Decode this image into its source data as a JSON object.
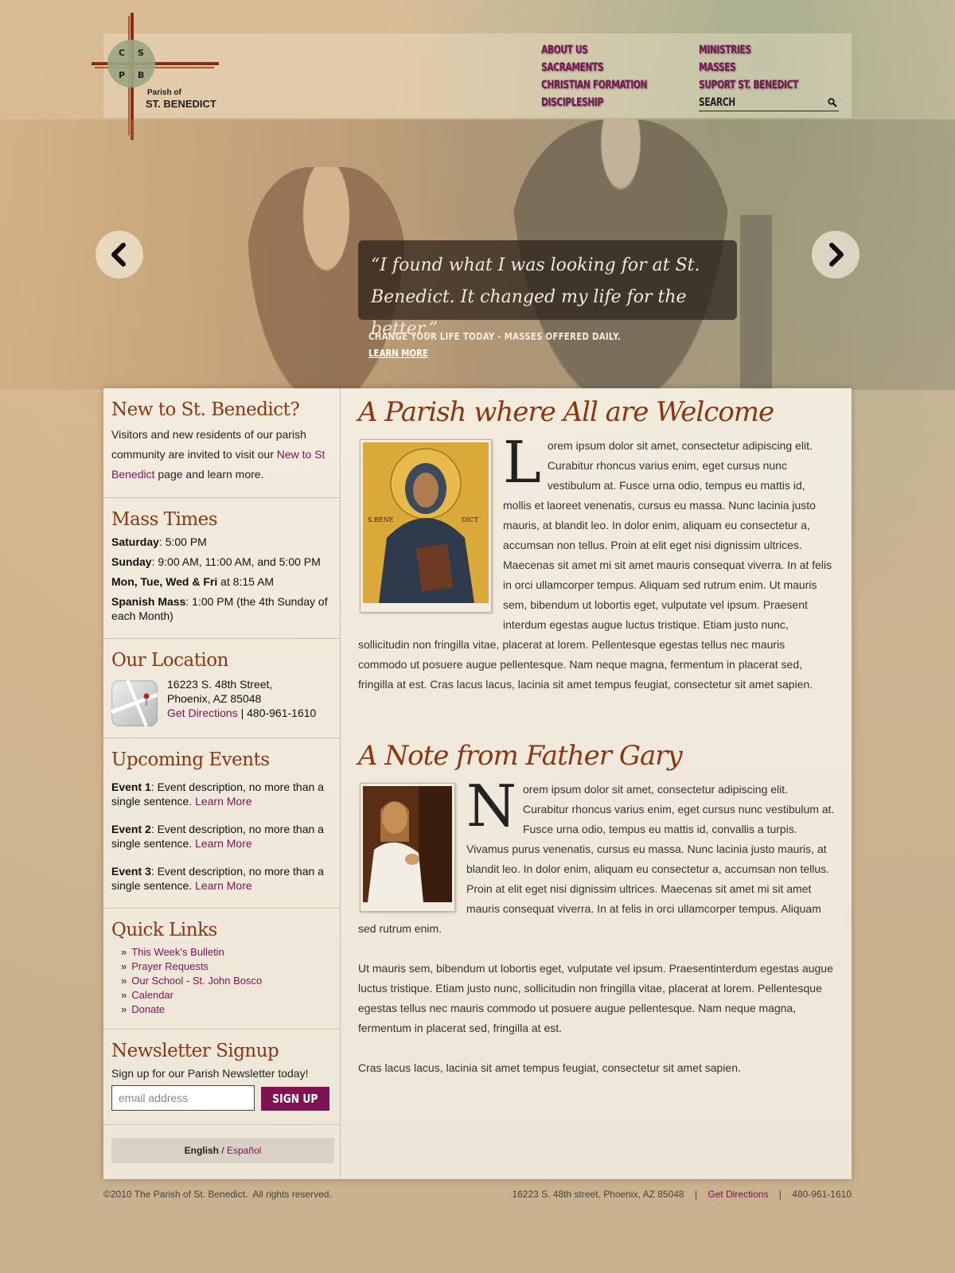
{
  "logo": {
    "letters": [
      "C",
      "S",
      "P",
      "B"
    ],
    "line1": "Parish of",
    "line2": "ST. BENEDICT"
  },
  "nav": {
    "left": [
      "ABOUT US",
      "SACRAMENTS",
      "CHRISTIAN FORMATION",
      "DISCIPLESHIP"
    ],
    "right": [
      "MINISTRIES",
      "MASSES",
      "SUPORT ST. BENEDICT"
    ],
    "search_label": "SEARCH"
  },
  "hero": {
    "quote": "“I found what I was looking for at St. Benedict. It changed my life for the better.”",
    "tagline": "CHANGE YOUR LIFE TODAY - MASSES OFFERED DAILY.",
    "link": "LEARN MORE"
  },
  "sidebar": {
    "new": {
      "title": "New to St. Benedict?",
      "text_before": "Visitors and new residents of our parish community are invited to visit our ",
      "link": "New to St Benedict",
      "text_after": " page and learn more."
    },
    "mass": {
      "title": "Mass Times",
      "lines": [
        {
          "label": "Saturday",
          "sep": ": ",
          "value": "5:00 PM"
        },
        {
          "label": "Sunday",
          "sep": ": ",
          "value": "9:00 AM, 11:00 AM, and 5:00 PM"
        },
        {
          "label": "Mon, Tue, Wed & Fri",
          "sep": " ",
          "value": "at 8:15 AM"
        },
        {
          "label": "Spanish Mass",
          "sep": ": ",
          "value": "1:00 PM (the 4th Sunday of each Month)"
        }
      ]
    },
    "location": {
      "title": "Our Location",
      "street": "16223 S. 48th Street,",
      "city": "Phoenix, AZ 85048",
      "directions": "Get Directions",
      "sep": " | ",
      "phone": "480-961-1610"
    },
    "events": {
      "title": "Upcoming Events",
      "items": [
        {
          "label": "Event 1",
          "desc": ": Event description, no more than a single sentence. ",
          "link": "Learn More"
        },
        {
          "label": "Event 2",
          "desc": ": Event description, no more than a single sentence. ",
          "link": "Learn More"
        },
        {
          "label": "Event 3",
          "desc": ": Event description, no more than a single sentence. ",
          "link": "Learn More"
        }
      ]
    },
    "quicklinks": {
      "title": "Quick Links",
      "bullet": "»",
      "items": [
        "This Week’s Bulletin",
        "Prayer Requests",
        "Our School - St. John Bosco",
        "Calendar",
        "Donate"
      ]
    },
    "newsletter": {
      "title": "Newsletter Signup",
      "text": "Sign up for our Parish Newsletter today!",
      "placeholder": "email address",
      "button": "SIGN UP"
    },
    "lang": {
      "current": "English",
      "sep": " / ",
      "other": "Español"
    }
  },
  "content": {
    "welcome": {
      "title": "A Parish where All are Welcome",
      "image_caption_left": "S.BENE",
      "image_caption_right": "DICT",
      "dropcap": "L",
      "body": "orem ipsum dolor sit amet, consectetur adipiscing elit. Curabitur rhoncus varius enim, eget cursus nunc vestibulum at. Fusce urna odio, tempus eu mattis id, mollis et laoreet venenatis, cursus eu massa. Nunc lacinia justo mauris, at blandit leo. In dolor enim, aliquam eu consectetur a, accumsan non tellus. Proin at elit eget nisi dignissim ultrices. Maecenas sit amet mi sit amet mauris consequat viverra. In at felis in orci ullamcorper tempus. Aliquam sed rutrum enim. Ut mauris sem, bibendum ut lobortis eget, vulputate vel ipsum. Praesent interdum egestas augue luctus tristique. Etiam justo nunc, sollicitudin non fringilla vitae, placerat at lorem. Pellentesque egestas tellus nec mauris commodo ut posuere augue pellentesque. Nam neque magna, fermentum in placerat sed, fringilla at est. Cras lacus lacus, lacinia sit amet tempus feugiat, consectetur sit amet sapien."
    },
    "note": {
      "title": "A Note from Father Gary",
      "dropcap": "N",
      "body1": "orem ipsum dolor sit amet, consectetur adipiscing elit. Curabitur rhoncus varius enim, eget cursus nunc vestibulum at. Fusce urna odio, tempus eu mattis id, convallis a turpis. Vivamus purus venenatis, cursus eu massa. Nunc lacinia justo mauris, at blandit leo. In dolor enim, aliquam eu consectetur a, accumsan non tellus. Proin at elit eget nisi dignissim ultrices. Maecenas sit amet mi sit amet mauris consequat viverra. In at felis in orci ullamcorper tempus. Aliquam sed rutrum enim.",
      "body2": "Ut mauris sem, bibendum ut lobortis eget, vulputate vel ipsum. Praesentinterdum egestas augue luctus tristique. Etiam justo nunc, sollicitudin non fringilla vitae, placerat at lorem. Pellentesque egestas tellus nec mauris commodo ut posuere augue pellentesque. Nam neque magna, fermentum in placerat sed, fringilla at est.",
      "body3": "Cras lacus lacus, lacinia sit amet tempus feugiat, consectetur sit amet sapien."
    }
  },
  "footer": {
    "copyright": "©2010 The Parish of St. Benedict.  All rights reserved.",
    "address": "16223 S. 48th street, Phoenix, AZ 85048",
    "sep": "|",
    "directions": "Get Directions",
    "phone": "480-961-1610"
  },
  "colors": {
    "accent": "#8a3610",
    "link": "#7a1458",
    "button": "#7e1253"
  }
}
